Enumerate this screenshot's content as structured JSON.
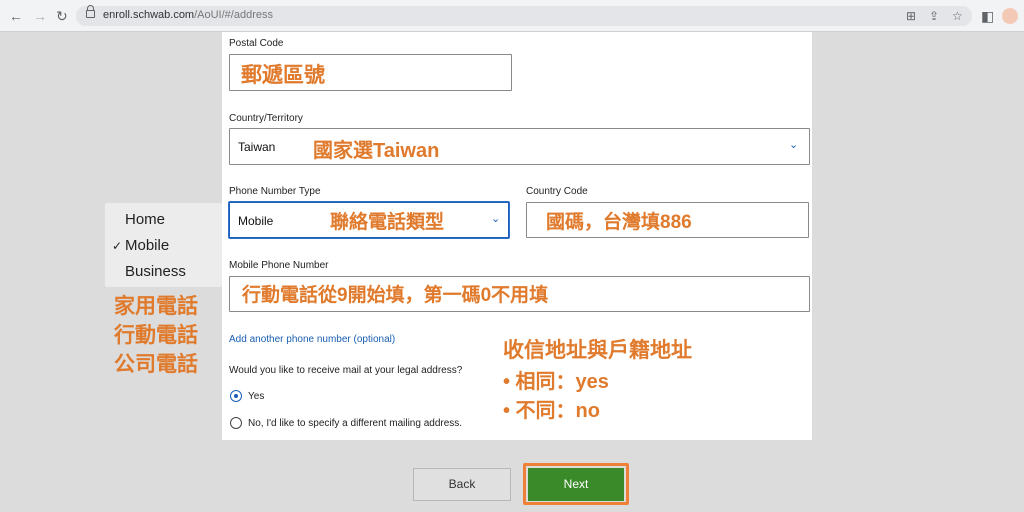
{
  "browser": {
    "url_host": "enroll.schwab.com",
    "url_path": "/AoUI/#/address"
  },
  "form": {
    "postal_code_label": "Postal Code",
    "postal_code_annotation": "郵遞區號",
    "country_label": "Country/Territory",
    "country_value": "Taiwan",
    "country_annotation": "國家選Taiwan",
    "phone_type_label": "Phone Number Type",
    "phone_type_value": "Mobile",
    "phone_type_annotation": "聯絡電話類型",
    "country_code_label": "Country Code",
    "country_code_annotation": "國碼，台灣填886",
    "mobile_label": "Mobile Phone Number",
    "mobile_annotation": "行動電話從9開始填，第一碼0不用填",
    "add_phone_link": "Add another phone number (optional)",
    "mail_question": "Would you like to receive mail at your legal address?",
    "options": [
      {
        "label": "Yes",
        "selected": true
      },
      {
        "label": "No, I'd like to specify a different mailing address.",
        "selected": false
      }
    ]
  },
  "dropdown": {
    "items": [
      "Home",
      "Mobile",
      "Business"
    ],
    "selected": "Mobile",
    "check": "✓"
  },
  "annotations": {
    "phone_types_zh": [
      "家用電話",
      "行動電話",
      "公司電話"
    ],
    "mail_title": "收信地址與戶籍地址",
    "mail_same": "• 相同：yes",
    "mail_diff": "• 不同：no"
  },
  "buttons": {
    "back": "Back",
    "next": "Next"
  },
  "colors": {
    "annotation": "#e07a2c",
    "next_button": "#3a8a2a",
    "accent": "#1a5fb4"
  }
}
